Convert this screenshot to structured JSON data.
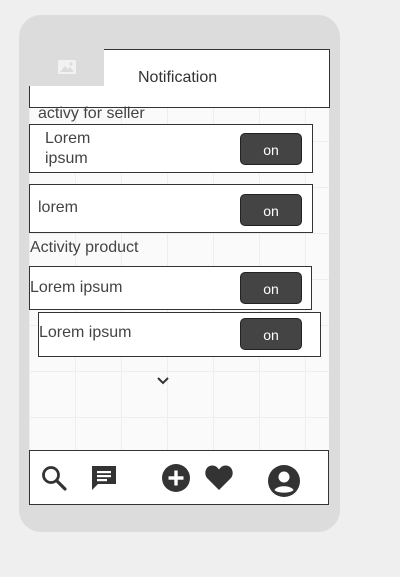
{
  "header": {
    "title": "Notification",
    "image_placeholder_icon": "image-icon"
  },
  "seller_section": {
    "label": "activy for seller",
    "items": [
      {
        "label": "Lorem\nipsum",
        "toggle": "on"
      },
      {
        "label": "lorem",
        "toggle": "on"
      }
    ]
  },
  "product_section": {
    "label": "Activity product",
    "items": [
      {
        "label": "Lorem ipsum",
        "toggle": "on"
      },
      {
        "label": "Lorem ipsum",
        "toggle": "on"
      }
    ]
  },
  "more_icon": "chevron-down-icon",
  "tabbar": {
    "icons": [
      "search-icon",
      "chat-icon",
      "add-circle-icon",
      "heart-icon",
      "account-icon"
    ]
  }
}
